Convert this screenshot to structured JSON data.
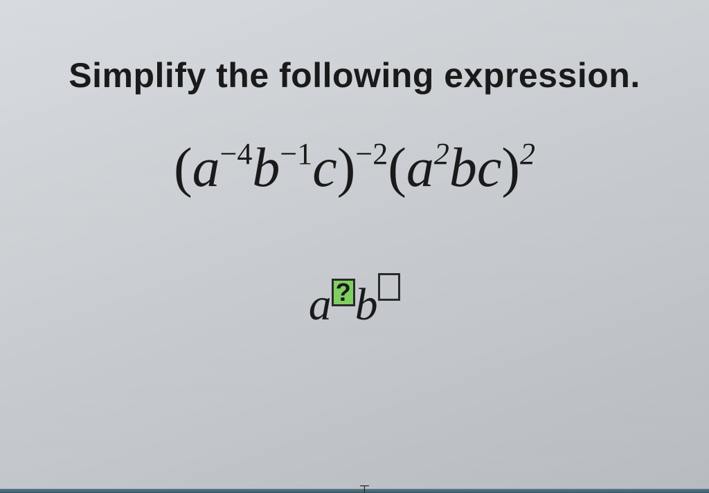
{
  "prompt": "Simplify the following expression.",
  "expression": {
    "group1": {
      "base_a": "a",
      "exp_a": "−4",
      "base_b": "b",
      "exp_b": "−1",
      "base_c": "c",
      "outer_exp": "−2"
    },
    "group2": {
      "base_a": "a",
      "exp_a": "2",
      "base_b": "b",
      "base_c": "c",
      "outer_exp": "2"
    }
  },
  "answer_template": {
    "base_a": "a",
    "box_a": "?",
    "base_b": "b",
    "box_b": ""
  }
}
